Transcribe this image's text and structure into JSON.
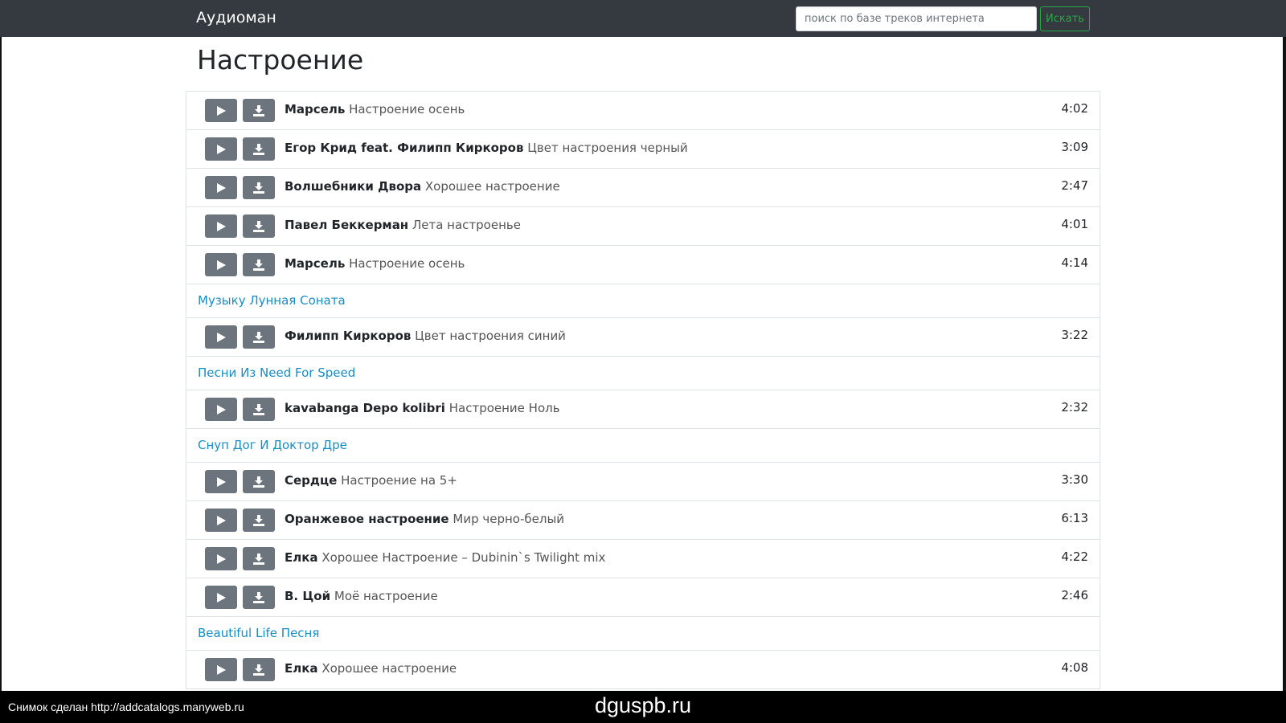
{
  "navbar": {
    "brand": "Аудиоман",
    "search_placeholder": "поиск по базе треков интернета",
    "search_value": "",
    "search_button": "Искать"
  },
  "page_title": "Настроение",
  "rows": [
    {
      "kind": "track",
      "artist": "Марсель",
      "title": "Настроение осень",
      "duration": "4:02"
    },
    {
      "kind": "track",
      "artist": "Егор Крид feat. Филипп Киркоров",
      "title": "Цвет настроения черный",
      "duration": "3:09"
    },
    {
      "kind": "track",
      "artist": "Волшебники Двора",
      "title": "Хорошее настроение",
      "duration": "2:47"
    },
    {
      "kind": "track",
      "artist": "Павел Беккерман",
      "title": "Лета настроенье",
      "duration": "4:01"
    },
    {
      "kind": "track",
      "artist": "Марсель",
      "title": "Настроение осень",
      "duration": "4:14"
    },
    {
      "kind": "link",
      "text": "Музыку Лунная Соната"
    },
    {
      "kind": "track",
      "artist": "Филипп Киркоров",
      "title": "Цвет настроения синий",
      "duration": "3:22"
    },
    {
      "kind": "link",
      "text": "Песни Из Need For Speed"
    },
    {
      "kind": "track",
      "artist": "kavabanga Depo kolibri",
      "title": "Настроение Ноль",
      "duration": "2:32"
    },
    {
      "kind": "link",
      "text": "Снуп Дог И Доктор Дре"
    },
    {
      "kind": "track",
      "artist": "Сердце",
      "title": "Настроение на 5+",
      "duration": "3:30"
    },
    {
      "kind": "track",
      "artist": "Оранжевое настроение",
      "title": "Мир черно-белый",
      "duration": "6:13"
    },
    {
      "kind": "track",
      "artist": "Елка",
      "title": "Хорошее Настроение – Dubinin`s Twilight mix",
      "duration": "4:22"
    },
    {
      "kind": "track",
      "artist": "В. Цой",
      "title": "Моё настроение",
      "duration": "2:46"
    },
    {
      "kind": "link",
      "text": "Beautiful Life Песня"
    },
    {
      "kind": "track",
      "artist": "Елка",
      "title": "Хорошее настроение",
      "duration": "4:08"
    }
  ],
  "icons": {
    "play": "play-icon",
    "download": "download-icon"
  },
  "colors": {
    "navbar_bg": "#343a40",
    "button_bg": "#6c757d",
    "search_button": "#28a745",
    "link": "#1a8cc4"
  },
  "footer": {
    "left_caption": "Снимок сделан http://addcatalogs.manyweb.ru",
    "center_caption": "dguspb.ru"
  }
}
